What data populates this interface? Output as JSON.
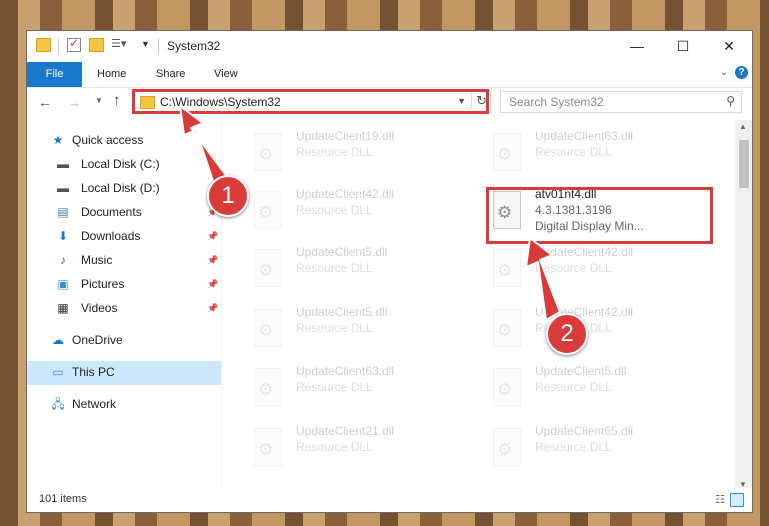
{
  "window": {
    "title": "System32",
    "controls": {
      "minimize": "—",
      "maximize": "☐",
      "close": "✕"
    }
  },
  "ribbon": {
    "tabs": [
      "File",
      "Home",
      "Share",
      "View"
    ],
    "help": "?"
  },
  "address": {
    "path": "C:\\Windows\\System32",
    "search_placeholder": "Search System32"
  },
  "sidebar": {
    "items": [
      {
        "label": "Quick access",
        "icon": "star-icon"
      },
      {
        "label": "Local Disk (C:)",
        "icon": "drive-icon"
      },
      {
        "label": "Local Disk (D:)",
        "icon": "drive-icon"
      },
      {
        "label": "Documents",
        "icon": "document-icon",
        "pinned": true
      },
      {
        "label": "Downloads",
        "icon": "download-icon",
        "pinned": true
      },
      {
        "label": "Music",
        "icon": "music-icon",
        "pinned": true
      },
      {
        "label": "Pictures",
        "icon": "picture-icon",
        "pinned": true
      },
      {
        "label": "Videos",
        "icon": "video-icon",
        "pinned": true
      },
      {
        "label": "OneDrive",
        "icon": "cloud-icon"
      },
      {
        "label": "This PC",
        "icon": "computer-icon",
        "selected": true
      },
      {
        "label": "Network",
        "icon": "network-icon"
      }
    ]
  },
  "files": {
    "col1": [
      {
        "name": "UpdateClient19.dll",
        "type": "Resource DLL"
      },
      {
        "name": "UpdateClient42.dll",
        "type": "Resource DLL"
      },
      {
        "name": "UpdateClient5.dll",
        "type": "Resource DLL"
      },
      {
        "name": "UpdateClient5.dll",
        "type": "Resource DLL"
      },
      {
        "name": "UpdateClient63.dll",
        "type": "Resource DLL"
      },
      {
        "name": "UpdateClient21.dll",
        "type": "Resource DLL"
      }
    ],
    "col2": [
      {
        "name": "UpdateClient63.dll",
        "type": "Resource DLL"
      },
      {
        "name": "UpdateClient42.dll",
        "type": "Resource DLL"
      },
      {
        "name": "UpdateClient42.dll",
        "type": "Resource DLL"
      },
      {
        "name": "UpdateClient5.dll",
        "type": "Resource DLL"
      },
      {
        "name": "UpdateClient65.dll",
        "type": "Resource DLL"
      }
    ],
    "highlighted": {
      "name": "atv01nt4.dll",
      "version": "4.3.1381.3196",
      "description": "Digital Display Min..."
    }
  },
  "status": {
    "items": "101 items"
  },
  "annotations": {
    "step1": "1",
    "step2": "2"
  },
  "colors": {
    "accent": "#1979ca",
    "highlight": "#d93a3a",
    "selected": "#cce8ff"
  }
}
